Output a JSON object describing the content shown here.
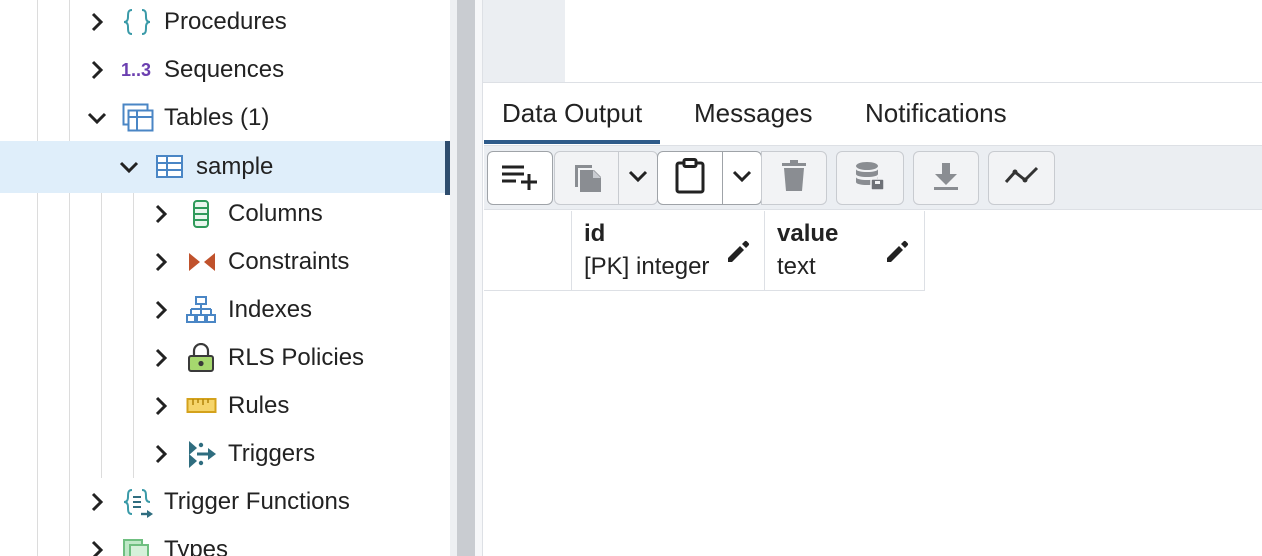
{
  "tree": {
    "items": [
      {
        "label": "Procedures",
        "icon": "procedures-icon",
        "expanded": false
      },
      {
        "label": "Sequences",
        "icon": "sequences-icon",
        "icon_text": "1..3",
        "expanded": false
      },
      {
        "label": "Tables (1)",
        "icon": "tables-icon",
        "expanded": true
      },
      {
        "label": "sample",
        "icon": "table-icon",
        "expanded": true,
        "selected": true
      },
      {
        "label": "Columns",
        "icon": "columns-icon",
        "expanded": false
      },
      {
        "label": "Constraints",
        "icon": "constraints-icon",
        "expanded": false
      },
      {
        "label": "Indexes",
        "icon": "indexes-icon",
        "expanded": false
      },
      {
        "label": "RLS Policies",
        "icon": "rls-policies-icon",
        "expanded": false
      },
      {
        "label": "Rules",
        "icon": "rules-icon",
        "expanded": false
      },
      {
        "label": "Triggers",
        "icon": "triggers-icon",
        "expanded": false
      },
      {
        "label": "Trigger Functions",
        "icon": "trigger-functions-icon",
        "expanded": false
      },
      {
        "label": "Types",
        "icon": "types-icon",
        "expanded": false
      }
    ]
  },
  "tabs": [
    {
      "label": "Data Output",
      "active": true
    },
    {
      "label": "Messages",
      "active": false
    },
    {
      "label": "Notifications",
      "active": false
    }
  ],
  "toolbar": {
    "buttons": [
      "add-row-icon",
      "copy-icon",
      "copy-dropdown-icon",
      "paste-icon",
      "paste-dropdown-icon",
      "delete-icon",
      "save-data-icon",
      "download-icon",
      "graph-visualiser-icon"
    ]
  },
  "grid": {
    "columns": [
      {
        "name": "id",
        "type": "[PK] integer"
      },
      {
        "name": "value",
        "type": "text"
      }
    ]
  },
  "colors": {
    "accent": "#2e5b8a",
    "selected_row": "#dfeefa",
    "toolbar_bg": "#ebeef2"
  }
}
